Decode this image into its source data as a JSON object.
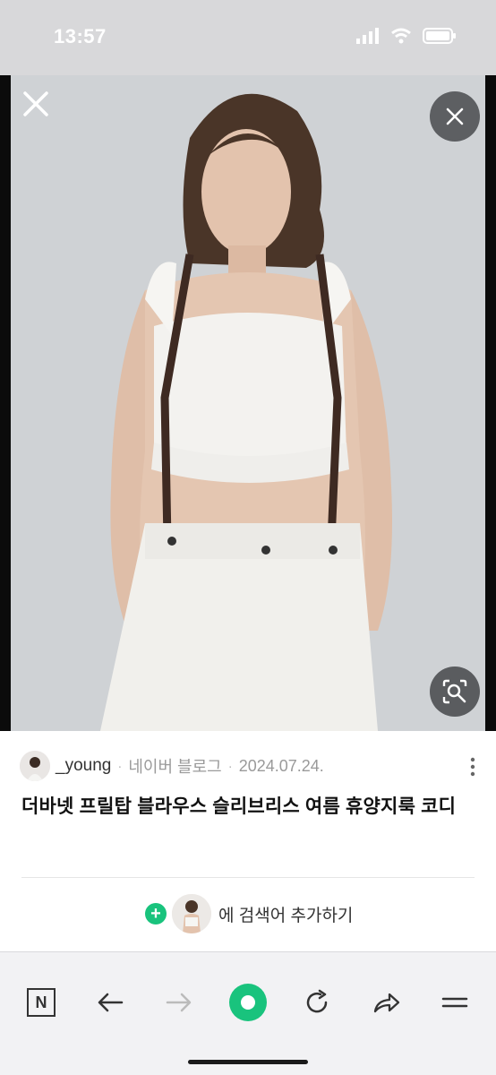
{
  "status_bar": {
    "time": "13:57",
    "icons": [
      "signal-icon",
      "wifi-icon",
      "battery-icon"
    ]
  },
  "viewer": {
    "close_icon": "close-icon",
    "close_circle_icon": "close-icon",
    "lens_icon": "image-search-icon"
  },
  "post": {
    "author": "_young",
    "source": "네이버 블로그",
    "date": "2024.07.24.",
    "title": "더바넷 프릴탑 블라우스 슬리브리스 여름 휴양지룩 코디",
    "more_icon": "more-vertical-icon"
  },
  "add_search": {
    "plus_icon": "plus-icon",
    "label": "에 검색어 추가하기"
  },
  "toolbar": {
    "items": [
      "N",
      "back-arrow-icon",
      "forward-arrow-icon",
      "green-dot-icon",
      "refresh-icon",
      "share-icon",
      "menu-icon"
    ]
  },
  "colors": {
    "accent": "#19c37d",
    "photo_bg": "#cdd0d3",
    "toolbar_bg": "#f2f2f4"
  }
}
